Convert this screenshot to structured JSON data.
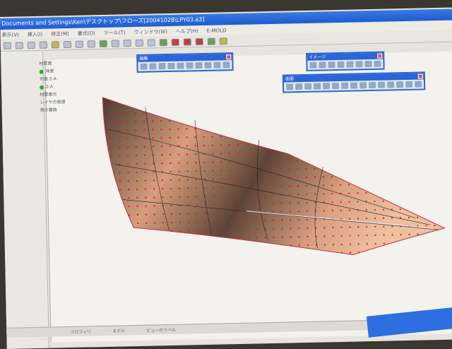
{
  "window": {
    "title": "Documents and Settings\\Ken\\デスクトップ\\フローズ[20041028\\LPY03.a3]"
  },
  "menu": [
    "表示(V)",
    "挿入(I)",
    "修正(M)",
    "書式(O)",
    "ツール(T)",
    "ウィンドウ(W)",
    "ヘルプ(H)",
    "E-MOLD"
  ],
  "tree": {
    "root": "材質建",
    "items": [
      "背景",
      "平面 2-A",
      "2-A",
      "材質表示",
      "レイヤの管理",
      "色の置換"
    ]
  },
  "palettes": {
    "edit": "編集",
    "image": "イメージ",
    "surface": "曲面"
  },
  "status": {
    "tab1": "フロフィリ",
    "tab2": "モデル",
    "coords": "ビューのラベル"
  },
  "colors": {
    "titlebar": "#1d5bd0",
    "surface": "#c48a6a",
    "points": "#d02030"
  }
}
